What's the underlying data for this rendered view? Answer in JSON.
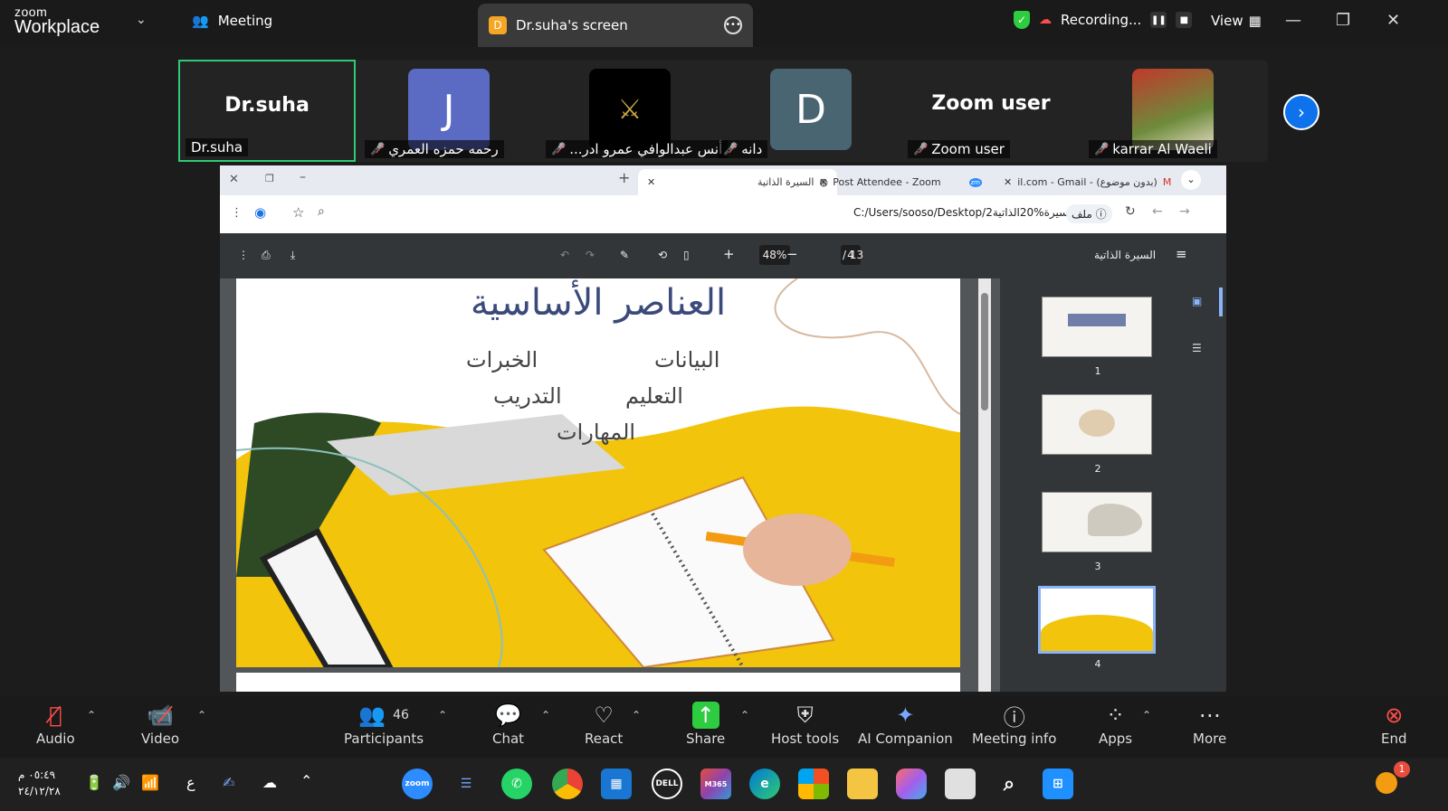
{
  "topbar": {
    "logo_top": "zoom",
    "logo_bottom": "Workplace",
    "meeting_tab": "Meeting",
    "screen_tab_badge": "D",
    "screen_tab_label": "Dr.suha's screen",
    "recording_label": "Recording...",
    "view_label": "View"
  },
  "participants": [
    {
      "name": "Dr.suha",
      "big": "Dr.suha",
      "muted": false
    },
    {
      "name": "رحمه حمزه العمري",
      "avatar_letter": "J",
      "avatar_color": "#5b6bc4",
      "muted": true
    },
    {
      "name": "...أنس عبدالوافي عمرو ادر",
      "muted": true
    },
    {
      "name": "دانه",
      "muted": true,
      "avatar_letter": "D",
      "avatar_color": "#4a6572"
    },
    {
      "name": "Zoom user",
      "big": "Zoom user",
      "muted": true
    },
    {
      "name": "karrar Al Waeli",
      "muted": true
    }
  ],
  "browser": {
    "tabs": [
      {
        "label": "السيرة الذاتية",
        "active": true
      },
      {
        "label": "Post Attendee - Zoom",
        "active": false
      },
      {
        "label": "il.com - Gmail - (بدون موضوع)",
        "active": false
      }
    ],
    "url": "C:/Users/sooso/Desktop/2السيرة%20الذاتية.pdf",
    "url_prefix": "ملف",
    "pdf_title": "السيرة الذاتية",
    "zoom": "48%",
    "page_current": "4",
    "page_total": "/ 13"
  },
  "slide": {
    "title": "العناصر الأساسية",
    "items": [
      "البيانات",
      "الخبرات",
      "التعليم",
      "التدريب",
      "المهارات"
    ]
  },
  "thumbnails": [
    "1",
    "2",
    "3",
    "4"
  ],
  "toolbar": {
    "audio": "Audio",
    "video": "Video",
    "participants": "Participants",
    "participants_count": "46",
    "chat": "Chat",
    "react": "React",
    "share": "Share",
    "host_tools": "Host tools",
    "ai_companion": "AI Companion",
    "meeting_info": "Meeting info",
    "apps": "Apps",
    "more": "More",
    "end": "End"
  },
  "taskbar": {
    "time": "٠٥:٤٩ م",
    "date": "٢٤/١٢/٢٨",
    "lang": "ع",
    "notification_count": "1"
  },
  "colors": {
    "accent_blue": "#0e72ed",
    "active_green": "#2ecc71",
    "mute_red": "#ff4d4d",
    "slide_title": "#3b4a7a",
    "slide_yellow": "#f2c40c"
  }
}
